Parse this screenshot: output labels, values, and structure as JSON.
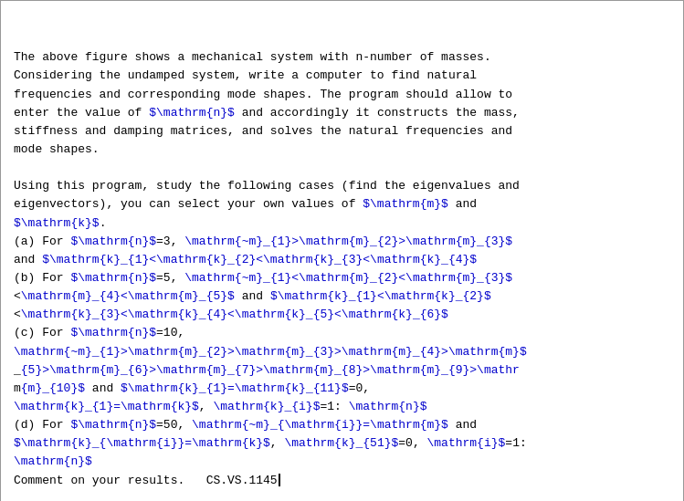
{
  "content": {
    "paragraph1": "The above figure shows a mechanical system with n-number of masses.\nConsidering the undamped system, write a computer to find natural\nfrequencies and corresponding mode shapes. The program should allow to\nenter the value of ",
    "paragraph1_math1": "$\\mathrm{n}$",
    "paragraph1_rest": " and accordingly it constructs the mass,\nstiffness and damping matrices, and solves the natural frequencies and\nmode shapes.",
    "paragraph2_start": "Using this program, study the following cases (find the eigenvalues and\neigenvectors), you can select your own values of ",
    "paragraph2_math1": "$\\mathrm{m}$",
    "paragraph2_and": " and\n",
    "paragraph2_math2": "$\\mathrm{k}$",
    "paragraph2_end": ".",
    "case_a_label": "(a) For ",
    "case_a_math1": "$\\mathrm{n}$",
    "case_a_eq": "=3, ",
    "case_a_math2": "\\mathrm{~m}_{1}>\\mathrm{m}_{2}>\\mathrm{m}_{3}$",
    "case_a_and": "\nand ",
    "case_a_math3": "$\\mathrm{k}_{1}<\\mathrm{k}_{2}<\\mathrm{k}_{3}<\\mathrm{k}_{4}$",
    "case_b_label": "(b) For ",
    "case_b_math1": "$\\mathrm{n}$",
    "case_b_rest": "=5, ",
    "case_c_label": "(c) For ",
    "case_c_math1": "$\\mathrm{n}$",
    "case_c_rest": "=10,",
    "case_d_label": "(d) For ",
    "case_d_math1": "$\\mathrm{n}$",
    "case_d_rest": "=50,",
    "comment": "Comment on your results.   CS.VS.1145"
  }
}
